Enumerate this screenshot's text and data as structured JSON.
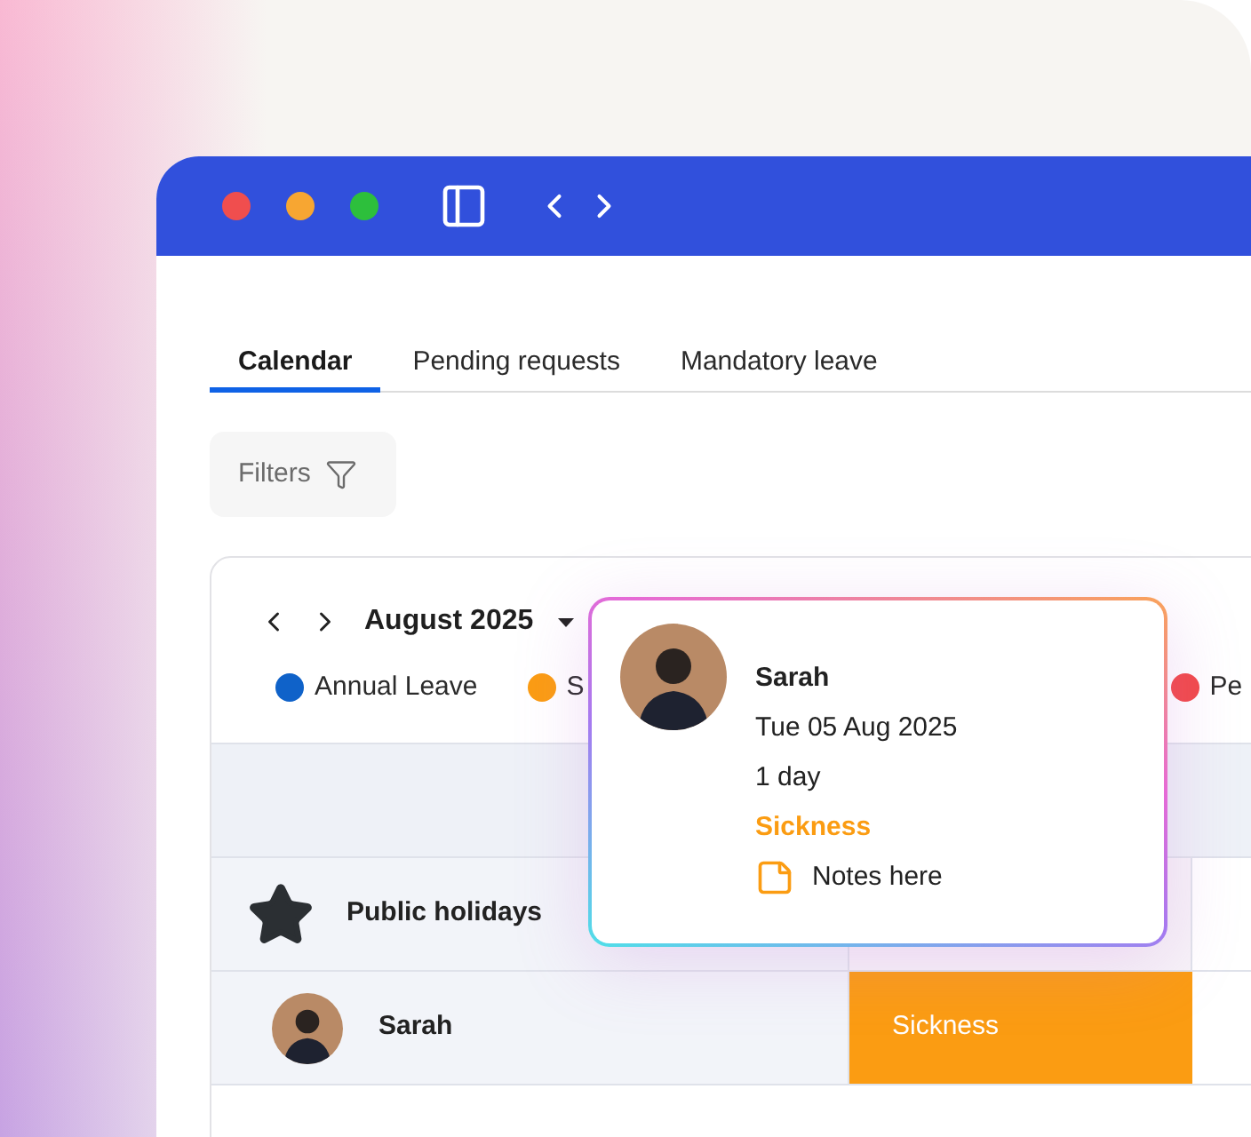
{
  "tabs": [
    {
      "label": "Calendar",
      "selected": true
    },
    {
      "label": "Pending requests",
      "selected": false
    },
    {
      "label": "Mandatory leave",
      "selected": false
    }
  ],
  "filters": {
    "label": "Filters"
  },
  "calendar": {
    "month": "August 2025",
    "legend": [
      {
        "label": "Annual Leave",
        "color": "#0f62c9"
      },
      {
        "label": "S",
        "color": "#fb9c12"
      },
      {
        "label": "Pe",
        "color": "#f24848"
      }
    ],
    "rows": [
      {
        "kind": "holiday",
        "label": "Public holidays"
      },
      {
        "kind": "person",
        "name": "Sarah",
        "leave": {
          "label": "Sickness",
          "color": "#fb9c12"
        }
      }
    ]
  },
  "popover": {
    "name": "Sarah",
    "date": "Tue 05 Aug 2025",
    "duration": "1 day",
    "type": {
      "label": "Sickness",
      "color": "#fb9c12"
    },
    "notes": "Notes here"
  }
}
